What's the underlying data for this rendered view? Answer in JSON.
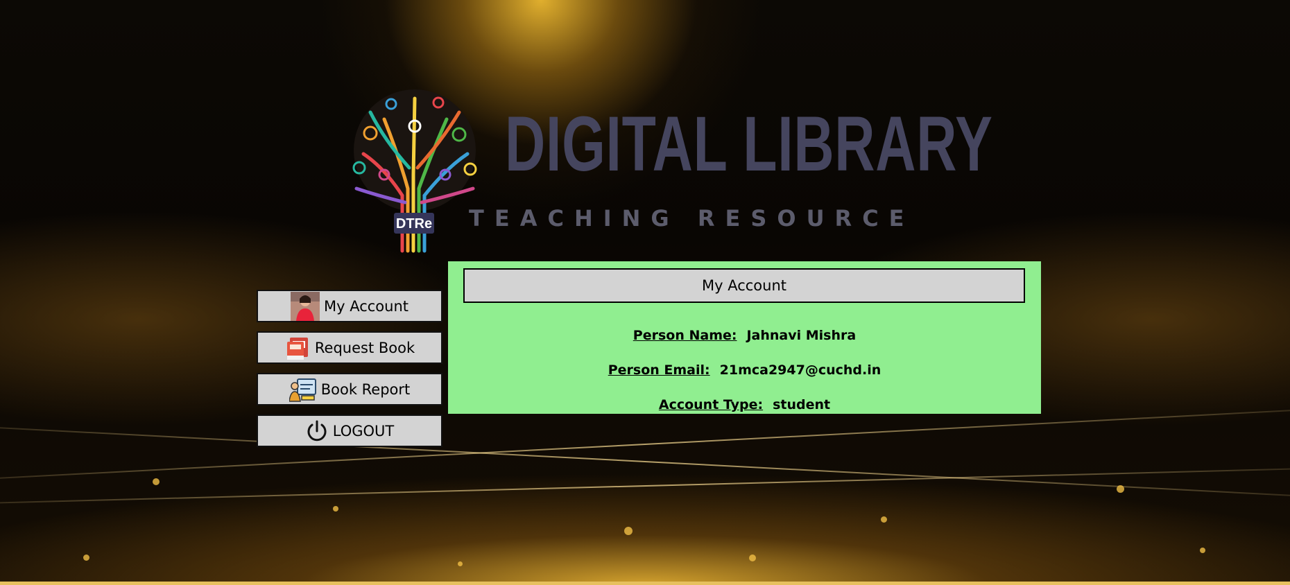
{
  "header": {
    "title": "DIGITAL LIBRARY",
    "subtitle": "TEACHING RESOURCE",
    "logo_text": "DTRe"
  },
  "sidebar": {
    "items": [
      {
        "label": "My Account",
        "icon": "avatar-photo-icon"
      },
      {
        "label": "Request Book",
        "icon": "book-icon"
      },
      {
        "label": "Book Report",
        "icon": "report-icon"
      },
      {
        "label": "LOGOUT",
        "icon": "power-icon"
      }
    ]
  },
  "account": {
    "heading": "My Account",
    "fields": [
      {
        "label": "Person Name:",
        "value": "Jahnavi Mishra"
      },
      {
        "label": "Person Email:",
        "value": "21mca2947@cuchd.in"
      },
      {
        "label": "Account Type:",
        "value": "student"
      }
    ]
  },
  "colors": {
    "panel_bg": "#90ee90",
    "button_bg": "#d3d3d3",
    "title": "#45455e",
    "subtitle": "#5c5c6c"
  }
}
